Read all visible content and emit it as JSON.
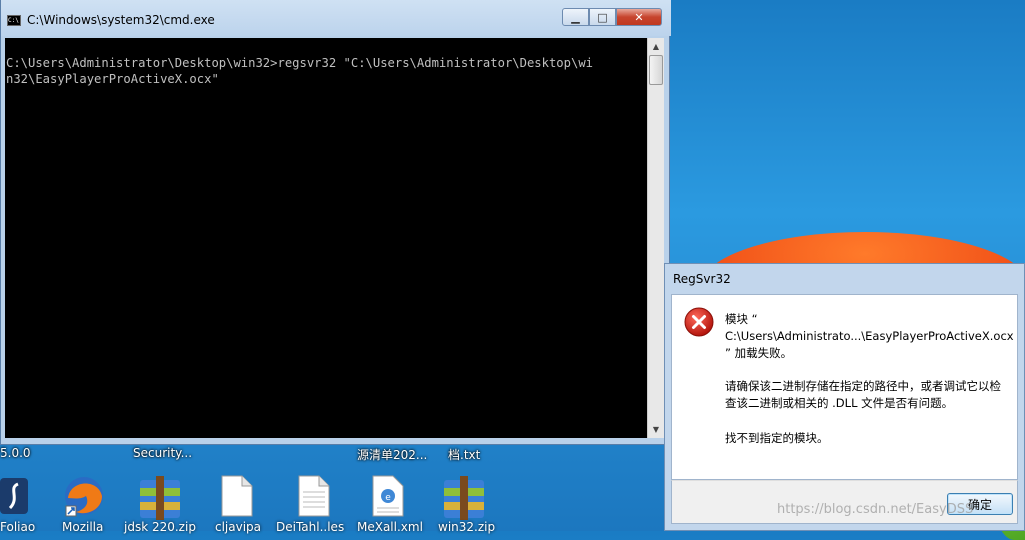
{
  "cmd_window": {
    "title": "C:\\Windows\\system32\\cmd.exe",
    "icon_label": "C:\\",
    "console_text": "C:\\Users\\Administrator\\Desktop\\win32>regsvr32 \"C:\\Users\\Administrator\\Desktop\\wi\nn32\\EasyPlayerProActiveX.ocx\"",
    "min_glyph": "▁",
    "max_glyph": "□",
    "close_glyph": "✕"
  },
  "dialog": {
    "title": "RegSvr32",
    "lines": [
      "模块 “",
      "C:\\Users\\Administrato...\\EasyPlayerProActiveX.ocx",
      "” 加载失败。",
      "请确保该二进制存储在指定的路径中，或者调试它以检",
      "查该二进制或相关的 .DLL 文件是否有问题。",
      "找不到指定的模块。"
    ],
    "ok_label": "确定"
  },
  "desktop": {
    "labels_top": [
      "5.0.0",
      "Security...",
      "源清单202...",
      "档.txt"
    ],
    "labels_bottom": [
      "Foliao",
      "Mozilla",
      "jdsk 220.zip",
      "cljavipa",
      "DeiTahl..les",
      "MeXall.xml",
      "win32.zip"
    ]
  },
  "watermark": "https://blog.csdn.net/EasyDSS"
}
